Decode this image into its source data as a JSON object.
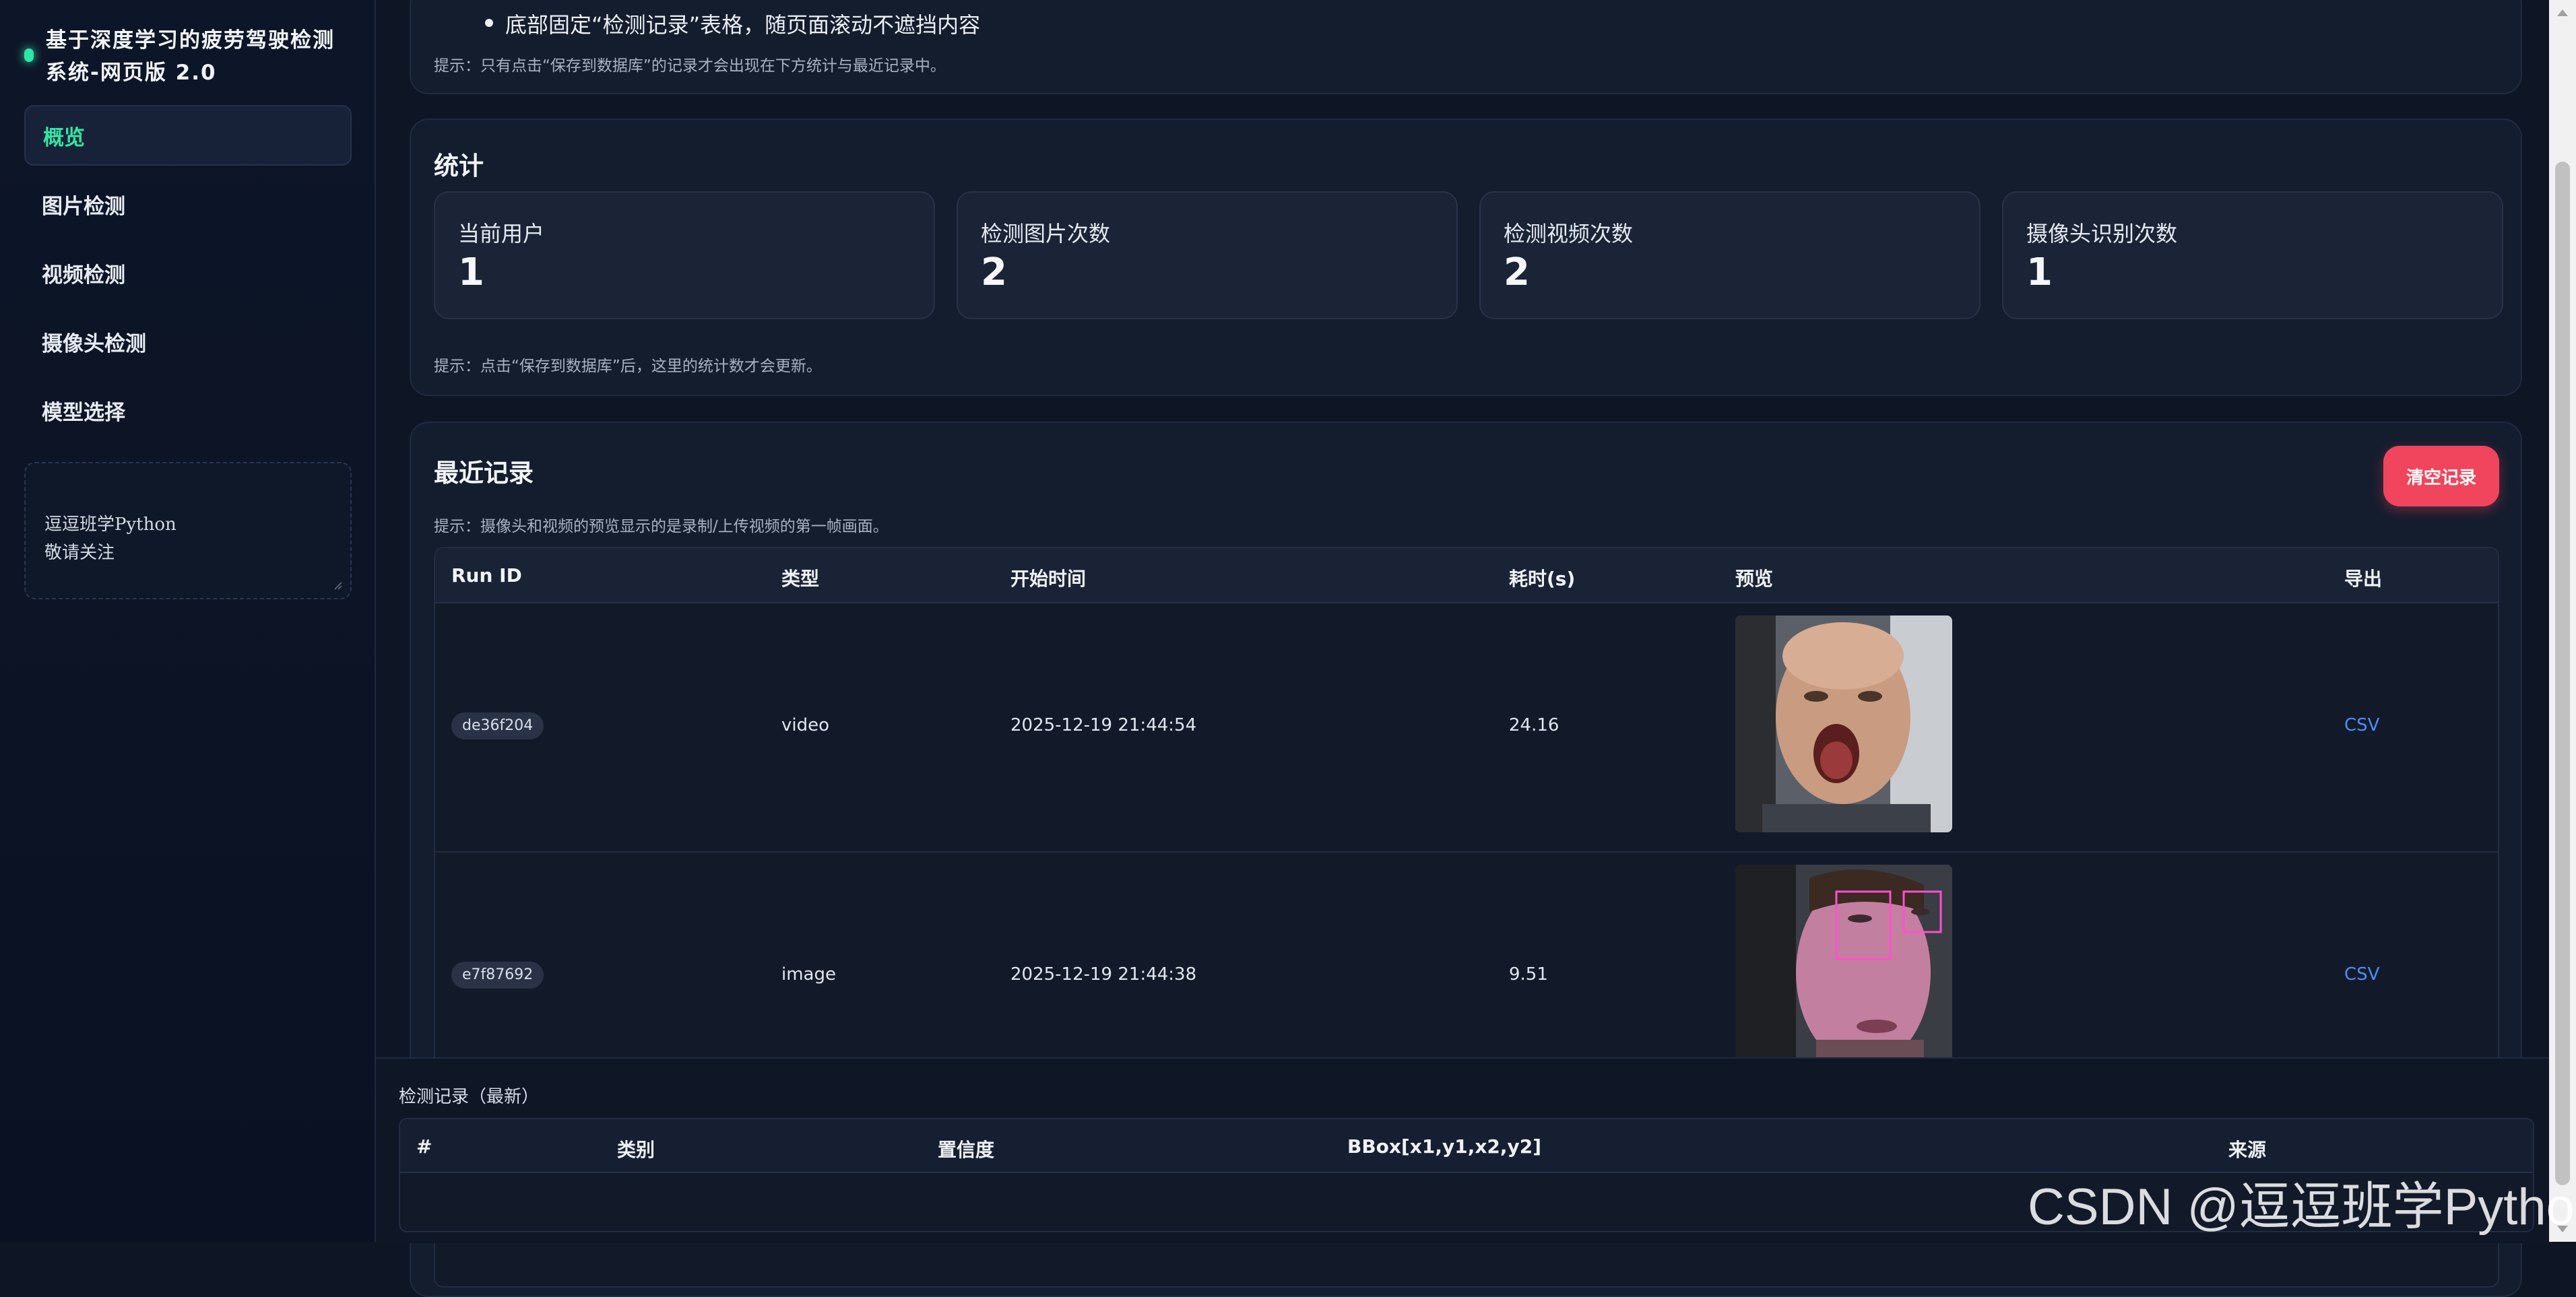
{
  "app": {
    "title": "基于深度学习的疲劳驾驶检测系统-网页版 2.0"
  },
  "sidebar": {
    "items": [
      {
        "label": "概览",
        "active": true
      },
      {
        "label": "图片检测"
      },
      {
        "label": "视频检测"
      },
      {
        "label": "摄像头检测"
      },
      {
        "label": "模型选择"
      }
    ],
    "note": "逗逗班学Python\n敬请关注"
  },
  "intro": {
    "bullet": "底部固定“检测记录”表格，随页面滚动不遮挡内容",
    "hint": "提示：只有点击“保存到数据库”的记录才会出现在下方统计与最近记录中。"
  },
  "stats": {
    "title": "统计",
    "cards": [
      {
        "label": "当前用户",
        "value": "1"
      },
      {
        "label": "检测图片次数",
        "value": "2"
      },
      {
        "label": "检测视频次数",
        "value": "2"
      },
      {
        "label": "摄像头识别次数",
        "value": "1"
      }
    ],
    "hint": "提示：点击“保存到数据库”后，这里的统计数才会更新。"
  },
  "recent": {
    "title": "最近记录",
    "clear_label": "清空记录",
    "hint": "提示：摄像头和视频的预览显示的是录制/上传视频的第一帧画面。",
    "columns": [
      "Run ID",
      "类型",
      "开始时间",
      "耗时(s)",
      "预览",
      "导出"
    ],
    "rows": [
      {
        "run_id": "de36f204",
        "type": "video",
        "start": "2025-12-19 21:44:54",
        "duration": "24.16",
        "export": "CSV"
      },
      {
        "run_id": "e7f87692",
        "type": "image",
        "start": "2025-12-19 21:44:38",
        "duration": "9.51",
        "export": "CSV"
      }
    ]
  },
  "detections": {
    "title": "检测记录（最新）",
    "columns": [
      "#",
      "类别",
      "置信度",
      "BBox[x1,y1,x2,y2]",
      "来源"
    ]
  },
  "watermark": "CSDN @逗逗班学Python",
  "colors": {
    "accent": "#34e3a4",
    "danger": "#f0455c",
    "link": "#4e8df5",
    "bg": "#0e1524"
  }
}
